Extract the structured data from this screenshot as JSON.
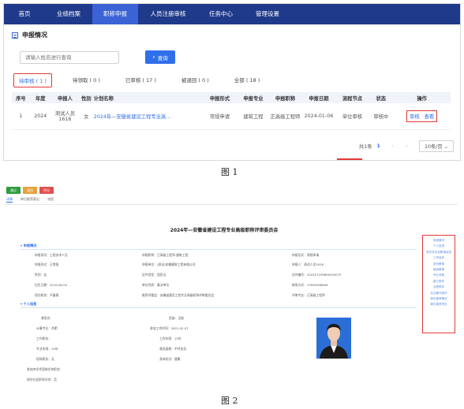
{
  "fig1": {
    "nav": [
      "首页",
      "业绩档案",
      "职称申报",
      "人员注册审核",
      "任务中心",
      "管理设置"
    ],
    "nav_active": 2,
    "panel_title": "申报情况",
    "search_placeholder": "请输入姓名进行查询",
    "search_button": "查询",
    "tabs": [
      "待审核 ( 1 )",
      "待领取 ( 0 )",
      "已审核 ( 17 )",
      "被退回 ( 0 )",
      "全部 ( 18 )"
    ],
    "table": {
      "headers": [
        "序号",
        "年度",
        "申报人",
        "性别",
        "计划名称",
        "申报形式",
        "申报专业",
        "申报职称",
        "申报日期",
        "流程节点",
        "状态",
        "操作"
      ],
      "row": {
        "index": "1",
        "year": "2024",
        "applicant": "测试人员1616",
        "gender": "女",
        "plan": "2024年—安徽省建设工程专业高...",
        "form": "常规申请",
        "major": "建筑工程",
        "title": "正高级工程师",
        "date": "2024-01-06",
        "node": "单位审核",
        "status": "审核中",
        "op_review": "审核",
        "op_view": "查看"
      }
    },
    "pager": {
      "total": "共1条",
      "current": "1",
      "page_size": "10条/页"
    },
    "caption": "图 1"
  },
  "fig2": {
    "buttons": [
      {
        "label": "通过",
        "color": "#2e9c3e"
      },
      {
        "label": "退回",
        "color": "#e6a23c"
      },
      {
        "label": "评分",
        "color": "#e05151"
      }
    ],
    "subtabs": [
      "详情",
      "单位推荐意见",
      "流程"
    ],
    "doc_title": "2024年—安徽省建设工程专业高级职称评审委员会",
    "section1": "申报情况",
    "section2": "个人信息",
    "col1": [
      "申报系列：工程技术人员",
      "申报形式：正常报",
      "性别：女",
      "出生日期：2019-08-04",
      "现任职务：不备案"
    ],
    "col2": [
      "申报职称：正高级工程师-建筑工程",
      "申报单位：(测试)安徽建筑工程有限公司",
      "证件类型：居民证",
      "单位性质：事业单位",
      "推荐评委会：安徽省建设工程专业高级职称评审委员会"
    ],
    "col3": [
      "申报形式：常规申请",
      "申报人：测试人员1616",
      "证件编号：432427199809020075",
      "联系方式：13950508806",
      "评审专业：正高级工程师"
    ],
    "personal_left": [
      "曾用名：",
      "从事专业：合肥",
      "工作职务：",
      "专业年限：10年",
      "现岗职务：无"
    ],
    "personal_mid": [
      "民族：汉族",
      "参加工作时间：2001-02-07",
      "工作年限：15年",
      "政治面貌：中共党员",
      "身体状况：健康"
    ],
    "personal_extra": [
      "参加何学术团体任何职务：",
      "现任社会职务任务：否"
    ],
    "side_nav": [
      "申报情况",
      "个人信息",
      "学历学位及教育经历",
      "工作经历",
      "学历教育",
      "继续教育",
      "专业考核",
      "能力条件",
      "业绩条件",
      "论文著作条件",
      "单位推荐情况",
      "单位推荐意见"
    ],
    "caption": "图 2"
  }
}
